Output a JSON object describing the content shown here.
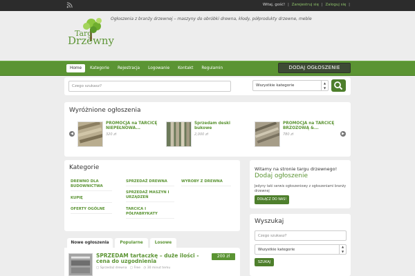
{
  "topbar": {
    "greeting": "Witaj, gość!",
    "register_label": "Zarejestruj się",
    "login_label": "Zaloguj się"
  },
  "header": {
    "logo_line1": "Targ",
    "logo_line2": "Drzewny",
    "tagline": "Ogłoszenia z branży drzewnej – maszyny do obróbki drewna, kłody, półprodukty drzewne, meble"
  },
  "nav": {
    "items": [
      "Home",
      "Kategorie",
      "Rejestracja",
      "Logowanie",
      "Kontakt",
      "Regulamin"
    ],
    "add_button": "DODAJ OGŁOSZENIE"
  },
  "search": {
    "placeholder": "Czego szukasz?",
    "category_value": "Wszystkie kategorie"
  },
  "featured": {
    "title": "Wyróżnione ogłoszenia",
    "items": [
      {
        "title": "PROMOCJA na TARCICĘ NIEPEŁNOWA...",
        "price": "320 zł"
      },
      {
        "title": "Sprzedam deski bukowe",
        "price": "2,000 zł"
      },
      {
        "title": "PROMOCJA na TARCICĘ BRZOZOWĄ &...",
        "price": "780 zł"
      }
    ]
  },
  "categories": {
    "title": "Kategorie",
    "items": [
      "DREWNO DLA BUDOWNICTWA",
      "KUPIĘ",
      "OFERTY OGÓLNE",
      "SPRZEDAŻ DREWNA",
      "SPRZEDAŻ MASZYN I URZĄDZEŃ",
      "TARCICA I PÓŁFABRYKATY",
      "WYROBY Z DREWNA"
    ]
  },
  "welcome": {
    "hello": "Witamy na stronie targu drzewnego!",
    "add_title": "Dodaj ogłoszenie",
    "description": "Jedyny taki serwis ogłoszeniowy z ogłoszeniami branży drzewnej",
    "join_button": "DOŁĄCZ DO NAS!"
  },
  "side_search": {
    "title": "Wyszukaj",
    "placeholder": "Czego szukasz?",
    "category_value": "Wszystkie kategorie",
    "button": "SZUKAJ"
  },
  "tabs": [
    "Nowe ogłoszenia",
    "Popularne",
    "Losowe"
  ],
  "listing": {
    "title": "SPRZEDAM tartaczkę – duże ilości -cena do uzgodnienia",
    "price": "200 zł",
    "category": "Sprzedaż drewna",
    "views": "Free",
    "time": "30 minut temu"
  },
  "colors": {
    "brand_green": "#5b9433",
    "dark_button": "#3d4a35",
    "topbar": "#2c2c2c"
  }
}
